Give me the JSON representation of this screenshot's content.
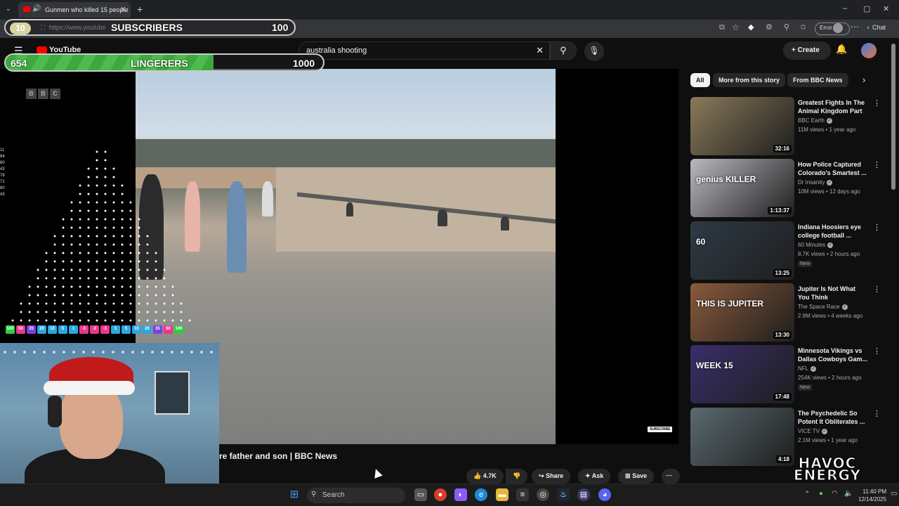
{
  "browser": {
    "tab_title": "Gunmen who killed 15 people",
    "url": "https://www.youtube",
    "error_label": "Error",
    "chat_label": "Chat"
  },
  "youtube": {
    "logo": "YouTube",
    "search_value": "australia shooting",
    "create_label": "Create",
    "video_title": "re father and son | BBC News",
    "likes": "4.7K",
    "share_label": "Share",
    "ask_label": "Ask",
    "save_label": "Save",
    "bbc_letters": [
      "B",
      "B",
      "C"
    ],
    "subscribe_watermark": "SUBSCRIBE"
  },
  "chips": [
    "All",
    "More from this story",
    "From BBC News"
  ],
  "recommendations": [
    {
      "title": "Greatest Fights In The Animal Kingdom Part ...",
      "channel": "BBC Earth",
      "meta": "11M views • 1 year ago",
      "duration": "32:16",
      "new": "",
      "thumb": "#8a7a5a"
    },
    {
      "title": "How Police Captured Colorado's Smartest ...",
      "channel": "Dr Insanity",
      "meta": "10M views • 12 days ago",
      "duration": "1:13:37",
      "new": "",
      "thumb": "#b8b8c0",
      "overlay": "genius KILLER"
    },
    {
      "title": "Indiana Hoosiers eye college football ...",
      "channel": "60 Minutes",
      "meta": "8.7K views • 2 hours ago",
      "duration": "13:25",
      "new": "New",
      "thumb": "#2e3a46",
      "overlay": "60"
    },
    {
      "title": "Jupiter Is Not What You Think",
      "channel": "The Space Race",
      "meta": "2.8M views • 4 weeks ago",
      "duration": "13:30",
      "new": "",
      "thumb": "#8a5a3a",
      "overlay": "THIS IS JUPITER"
    },
    {
      "title": "Minnesota Vikings vs Dallas Cowboys Gam...",
      "channel": "NFL",
      "meta": "254K views • 2 hours ago",
      "duration": "17:48",
      "new": "New",
      "thumb": "#3a2e6a",
      "overlay": "WEEK 15"
    },
    {
      "title": "The Psychedelic So Potent It Obliterates ...",
      "channel": "VICE TV",
      "meta": "2.1M views • 1 year ago",
      "duration": "4:18",
      "new": "",
      "thumb": "#5a6a70"
    }
  ],
  "overlays": {
    "subs_count": "10",
    "subs_label": "SUBSCRIBERS",
    "subs_goal": "100",
    "linger_count": "654",
    "linger_label": "LINGERERS",
    "linger_goal": "1000",
    "linger_progress": 0.654,
    "havoc_line1": "HAVOC",
    "havoc_line2": "ENERGY",
    "plinko_values": [
      {
        "v": "100",
        "c": "#2ecc40"
      },
      {
        "v": "50",
        "c": "#e8388a"
      },
      {
        "v": "35",
        "c": "#7b3fe4"
      },
      {
        "v": "20",
        "c": "#2aa7e0"
      },
      {
        "v": "10",
        "c": "#2aa7e0"
      },
      {
        "v": "5",
        "c": "#2aa7e0"
      },
      {
        "v": "1",
        "c": "#2aa7e0"
      },
      {
        "v": "-1",
        "c": "#e8388a"
      },
      {
        "v": "-2",
        "c": "#e8388a"
      },
      {
        "v": "-1",
        "c": "#e8388a"
      },
      {
        "v": "1",
        "c": "#2aa7e0"
      },
      {
        "v": "5",
        "c": "#2aa7e0"
      },
      {
        "v": "10",
        "c": "#2aa7e0"
      },
      {
        "v": "20",
        "c": "#2aa7e0"
      },
      {
        "v": "35",
        "c": "#7b3fe4"
      },
      {
        "v": "50",
        "c": "#e8388a"
      },
      {
        "v": "100",
        "c": "#2ecc40"
      }
    ],
    "side_numbers": [
      "11",
      "64",
      "60",
      "43",
      "78",
      "71",
      "80",
      "43"
    ]
  },
  "taskbar": {
    "search_label": "Search",
    "time": "11:40 PM",
    "date": "12/14/2025"
  }
}
